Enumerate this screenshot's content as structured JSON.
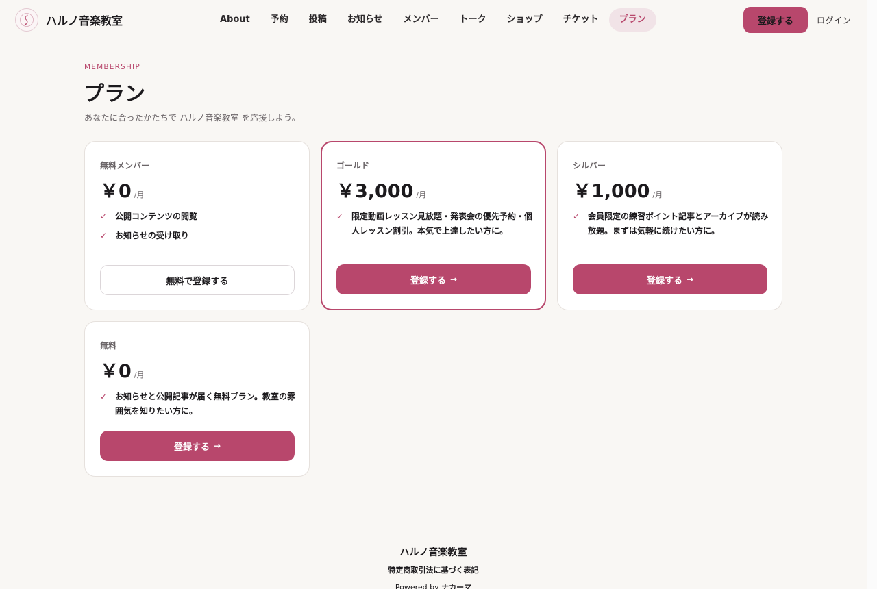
{
  "brand": {
    "name": "ハルノ音楽教室"
  },
  "nav": {
    "items": [
      {
        "label": "About"
      },
      {
        "label": "予約"
      },
      {
        "label": "投稿"
      },
      {
        "label": "お知らせ"
      },
      {
        "label": "メンバー"
      },
      {
        "label": "トーク"
      },
      {
        "label": "ショップ"
      },
      {
        "label": "チケット"
      },
      {
        "label": "プラン",
        "active": true
      }
    ],
    "register_label": "登録する",
    "login_label": "ログイン"
  },
  "hero": {
    "eyebrow": "MEMBERSHIP",
    "title": "プラン",
    "subtitle": "あなたに合ったかたちで ハルノ音楽教室 を応援しよう。"
  },
  "plans": [
    {
      "name": "無料メンバー",
      "price": "￥0",
      "unit": "/月",
      "features": [
        "公開コンテンツの閲覧",
        "お知らせの受け取り"
      ],
      "cta": "無料で登録する",
      "cta_style": "outline"
    },
    {
      "name": "ゴールド",
      "price": "￥3,000",
      "unit": "/月",
      "features": [
        "限定動画レッスン見放題・発表会の優先予約・個人レッスン割引。本気で上達したい方に。"
      ],
      "cta": "登録する",
      "cta_arrow": "→",
      "cta_style": "solid",
      "featured": true
    },
    {
      "name": "シルバー",
      "price": "￥1,000",
      "unit": "/月",
      "features": [
        "会員限定の練習ポイント記事とアーカイブが読み放題。まずは気軽に続けたい方に。"
      ],
      "cta": "登録する",
      "cta_arrow": "→",
      "cta_style": "solid"
    },
    {
      "name": "無料",
      "price": "￥0",
      "unit": "/月",
      "features": [
        "お知らせと公開記事が届く無料プラン。教室の雰囲気を知りたい方に。"
      ],
      "cta": "登録する",
      "cta_arrow": "→",
      "cta_style": "solid"
    }
  ],
  "footer": {
    "name": "ハルノ音楽教室",
    "legal_link": "特定商取引法に基づく表記",
    "powered_prefix": "Powered by",
    "powered_brand": "ナカーマ"
  },
  "colors": {
    "accent": "#b8476c",
    "background": "#f9f7f4",
    "card": "#ffffff",
    "text": "#1c1a1d"
  }
}
